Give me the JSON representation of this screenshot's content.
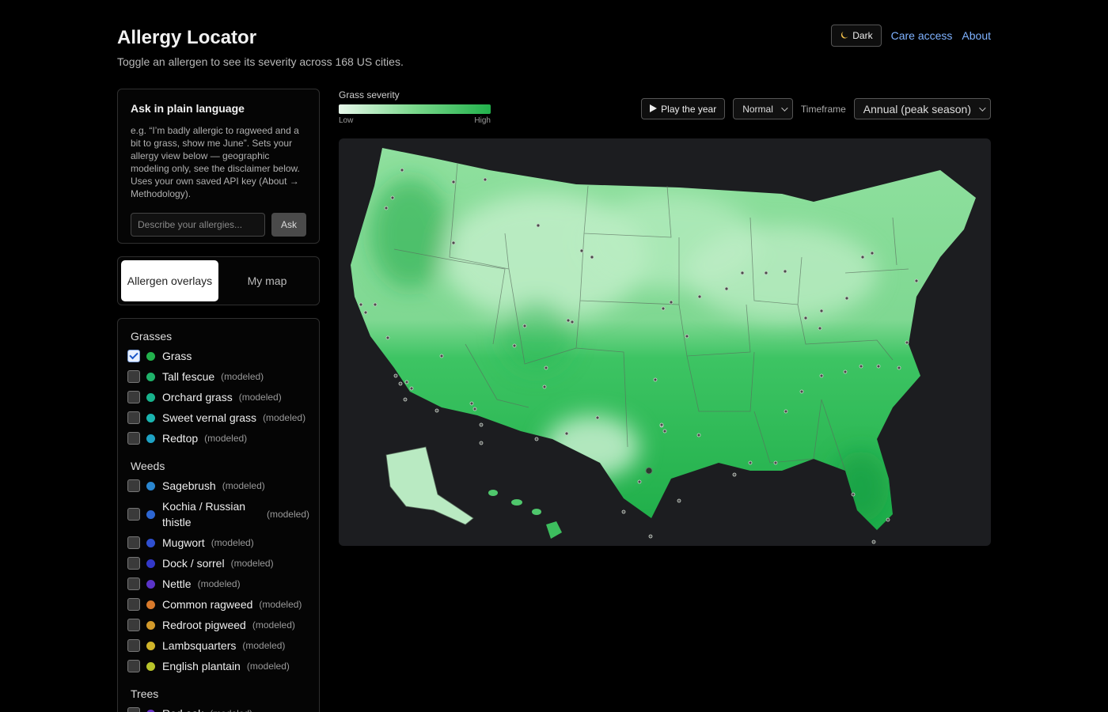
{
  "app": {
    "title": "Allergy Locator",
    "subtitle": "Toggle an allergen to see its severity across 168 US cities."
  },
  "top_actions": {
    "dark_icon": "moon-icon",
    "dark_label": "Dark",
    "care_access": "Care access",
    "about": "About"
  },
  "ask": {
    "heading": "Ask in plain language",
    "description": "e.g. “I’m badly allergic to ragweed and a bit to grass, show me June”. Sets your allergy view below — geographic modeling only, see the disclaimer below. Uses your own saved API key (About → Methodology).",
    "placeholder": "Describe your allergies...",
    "button": "Ask"
  },
  "tabs": [
    {
      "label": "Allergen overlays",
      "active": true
    },
    {
      "label": "My map",
      "active": false
    }
  ],
  "allergens": {
    "groups": [
      {
        "label": "Grasses",
        "items": [
          {
            "name": "Grass",
            "modeled": "",
            "checked": true,
            "color": "#22b14c"
          },
          {
            "name": "Tall fescue",
            "modeled": "(modeled)",
            "checked": false,
            "color": "#1fb26a"
          },
          {
            "name": "Orchard grass",
            "modeled": "(modeled)",
            "checked": false,
            "color": "#18b38c"
          },
          {
            "name": "Sweet vernal grass",
            "modeled": "(modeled)",
            "checked": false,
            "color": "#1ab5b0"
          },
          {
            "name": "Redtop",
            "modeled": "(modeled)",
            "checked": false,
            "color": "#1ea2c4"
          }
        ]
      },
      {
        "label": "Weeds",
        "items": [
          {
            "name": "Sagebrush",
            "modeled": "(modeled)",
            "checked": false,
            "color": "#2a86d0"
          },
          {
            "name": "Kochia / Russian thistle",
            "modeled": "(modeled)",
            "checked": false,
            "color": "#2d66d2"
          },
          {
            "name": "Mugwort",
            "modeled": "(modeled)",
            "checked": false,
            "color": "#2f4fd0"
          },
          {
            "name": "Dock / sorrel",
            "modeled": "(modeled)",
            "checked": false,
            "color": "#3338c8"
          },
          {
            "name": "Nettle",
            "modeled": "(modeled)",
            "checked": false,
            "color": "#5a34c8"
          },
          {
            "name": "Common ragweed",
            "modeled": "(modeled)",
            "checked": false,
            "color": "#d97a2b"
          },
          {
            "name": "Redroot pigweed",
            "modeled": "(modeled)",
            "checked": false,
            "color": "#d39a2b"
          },
          {
            "name": "Lambsquarters",
            "modeled": "(modeled)",
            "checked": false,
            "color": "#d0b52a"
          },
          {
            "name": "English plantain",
            "modeled": "(modeled)",
            "checked": false,
            "color": "#b8c42a"
          }
        ]
      },
      {
        "label": "Trees",
        "items": [
          {
            "name": "Red oak",
            "modeled": "(modeled)",
            "checked": false,
            "color": "#6a34c8"
          }
        ]
      }
    ]
  },
  "legend": {
    "title": "Grass severity",
    "low": "Low",
    "high": "High",
    "color_low": "#e7f7ea",
    "color_high": "#22b14c"
  },
  "controls": {
    "play_icon": "play-icon",
    "play_label": "Play the year",
    "speed": "Normal",
    "timeframe_label": "Timeframe",
    "timeframe": "Annual (peak season)"
  }
}
